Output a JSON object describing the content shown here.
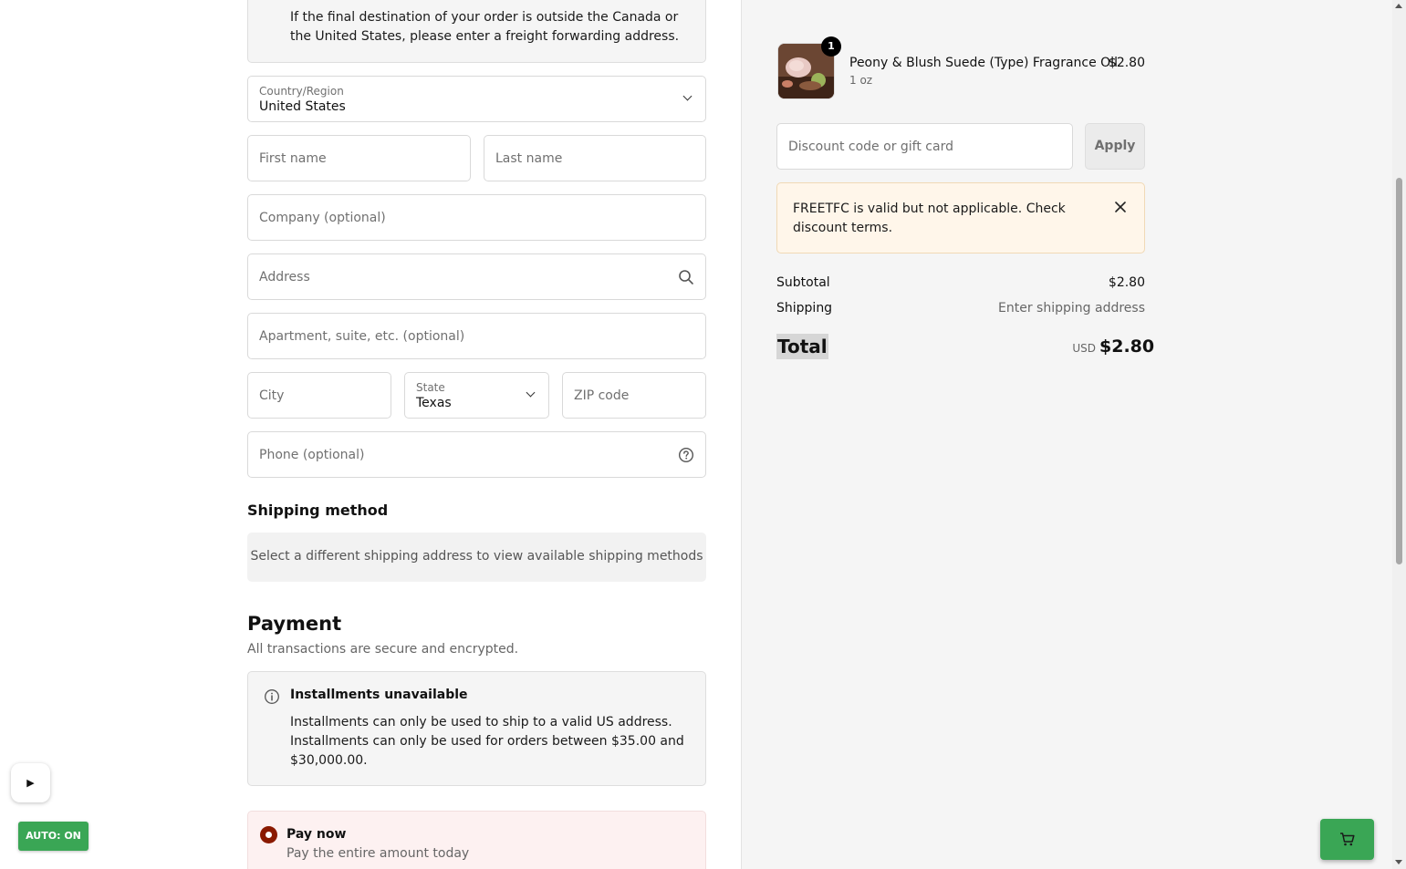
{
  "shipping_form": {
    "notice_text": "If the final destination of your order is outside the Canada or the United States, please enter a freight forwarding address.",
    "country": {
      "label": "Country/Region",
      "value": "United States"
    },
    "first_name_placeholder": "First name",
    "last_name_placeholder": "Last name",
    "company_placeholder": "Company (optional)",
    "address_placeholder": "Address",
    "apartment_placeholder": "Apartment, suite, etc. (optional)",
    "city_placeholder": "City",
    "state": {
      "label": "State",
      "value": "Texas"
    },
    "zip_placeholder": "ZIP code",
    "phone_placeholder": "Phone (optional)"
  },
  "shipping_method": {
    "title": "Shipping method",
    "message": "Select a different shipping address to view available shipping methods"
  },
  "payment": {
    "title": "Payment",
    "subtitle": "All transactions are secure and encrypted.",
    "installments_title": "Installments unavailable",
    "installments_line1": "Installments can only be used to ship to a valid US address.",
    "installments_line2": "Installments can only be used for orders between $35.00 and $30,000.00.",
    "pay_now_title": "Pay now",
    "pay_now_sub": "Pay the entire amount today"
  },
  "overlay": {
    "play_glyph": "▶",
    "auto_label": "AUTO: ON"
  },
  "order_summary": {
    "item": {
      "quantity": "1",
      "name": "Peony & Blush Suede (Type) Fragrance Oil",
      "variant": "1 oz",
      "price": "$2.80"
    },
    "discount_placeholder": "Discount code or gift card",
    "apply_label": "Apply",
    "alert_text": "FREETFC is valid but not applicable. Check discount terms.",
    "subtotal_label": "Subtotal",
    "subtotal_value": "$2.80",
    "shipping_label": "Shipping",
    "shipping_value": "Enter shipping address",
    "total_label": "Total",
    "total_currency": "USD",
    "total_value": "$2.80"
  },
  "colors": {
    "accent_green": "#3aa655",
    "radio_selected": "#8a1a00",
    "alert_bg": "#fff6ea"
  }
}
